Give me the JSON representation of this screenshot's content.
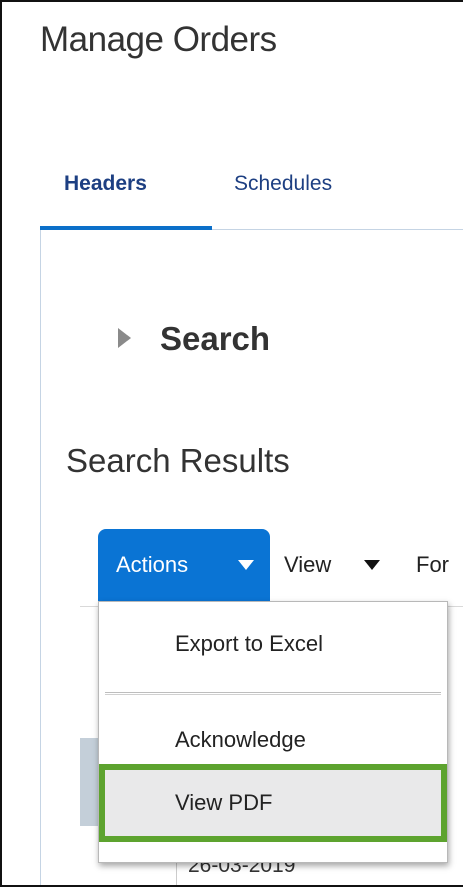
{
  "page": {
    "title": "Manage Orders"
  },
  "tabs": [
    {
      "label": "Headers",
      "selected": true
    },
    {
      "label": "Schedules",
      "selected": false
    }
  ],
  "search": {
    "label": "Search",
    "expanded": false
  },
  "results": {
    "title": "Search Results",
    "toolbar": {
      "actions_label": "Actions",
      "view_label": "View",
      "format_label": "For"
    },
    "visible_cell": "26-03-2019"
  },
  "actions_menu": {
    "items": [
      {
        "label": "Export to Excel"
      },
      {
        "label": "Acknowledge"
      },
      {
        "label": "View PDF",
        "highlighted": true
      }
    ]
  },
  "colors": {
    "accent": "#0a74d4",
    "tab_underline": "#0b6fc9",
    "highlight_border": "#5da32f",
    "link_text": "#1d3f82"
  }
}
